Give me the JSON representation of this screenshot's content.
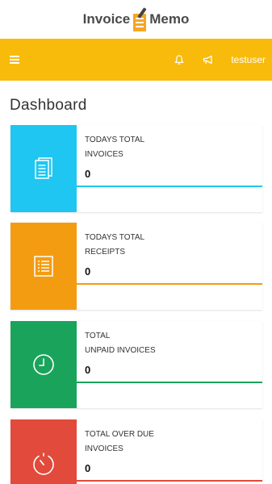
{
  "brand": {
    "left": "Invoice",
    "right": "Memo"
  },
  "topbar": {
    "username": "testuser"
  },
  "page_title": "Dashboard",
  "cards": [
    {
      "label_line1": "TODAYS TOTAL",
      "label_line2": "INVOICES",
      "value": "0",
      "color": "#1ec6f1",
      "icon": "invoice-list-icon"
    },
    {
      "label_line1": "TODAYS TOTAL",
      "label_line2": "RECEIPTS",
      "value": "0",
      "color": "#f39c12",
      "icon": "receipt-list-icon"
    },
    {
      "label_line1": "TOTAL",
      "label_line2": "UNPAID INVOICES",
      "value": "0",
      "color": "#1aa45b",
      "icon": "clock-icon"
    },
    {
      "label_line1": "TOTAL OVER DUE",
      "label_line2": "INVOICES",
      "value": "0",
      "color": "#e24a3b",
      "icon": "timer-icon"
    }
  ],
  "colors": {
    "header": "#f8bb0b"
  }
}
